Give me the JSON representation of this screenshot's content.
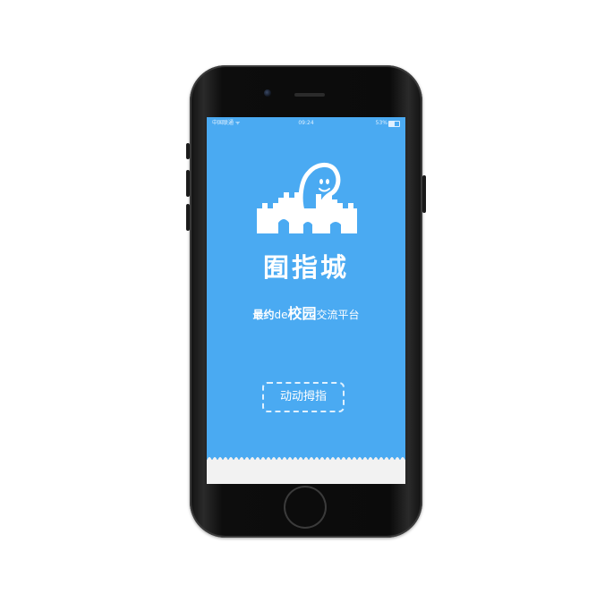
{
  "status_bar": {
    "carrier": "中国联通 ᯤ",
    "time": "09:24",
    "battery": "53%",
    "battery_level": 0.53
  },
  "app": {
    "brand": "囿指城",
    "slogan": {
      "part1": "最",
      "part2": "约",
      "part3": "de",
      "part4": "校园",
      "part5": "交流平台"
    },
    "cta_label": "动动拇指"
  },
  "colors": {
    "screen": "#4aaaf2",
    "footer": "#f2f2f2",
    "phone": "#0b0b0b"
  },
  "icons": [
    "castle-logo-icon",
    "battery-icon"
  ]
}
